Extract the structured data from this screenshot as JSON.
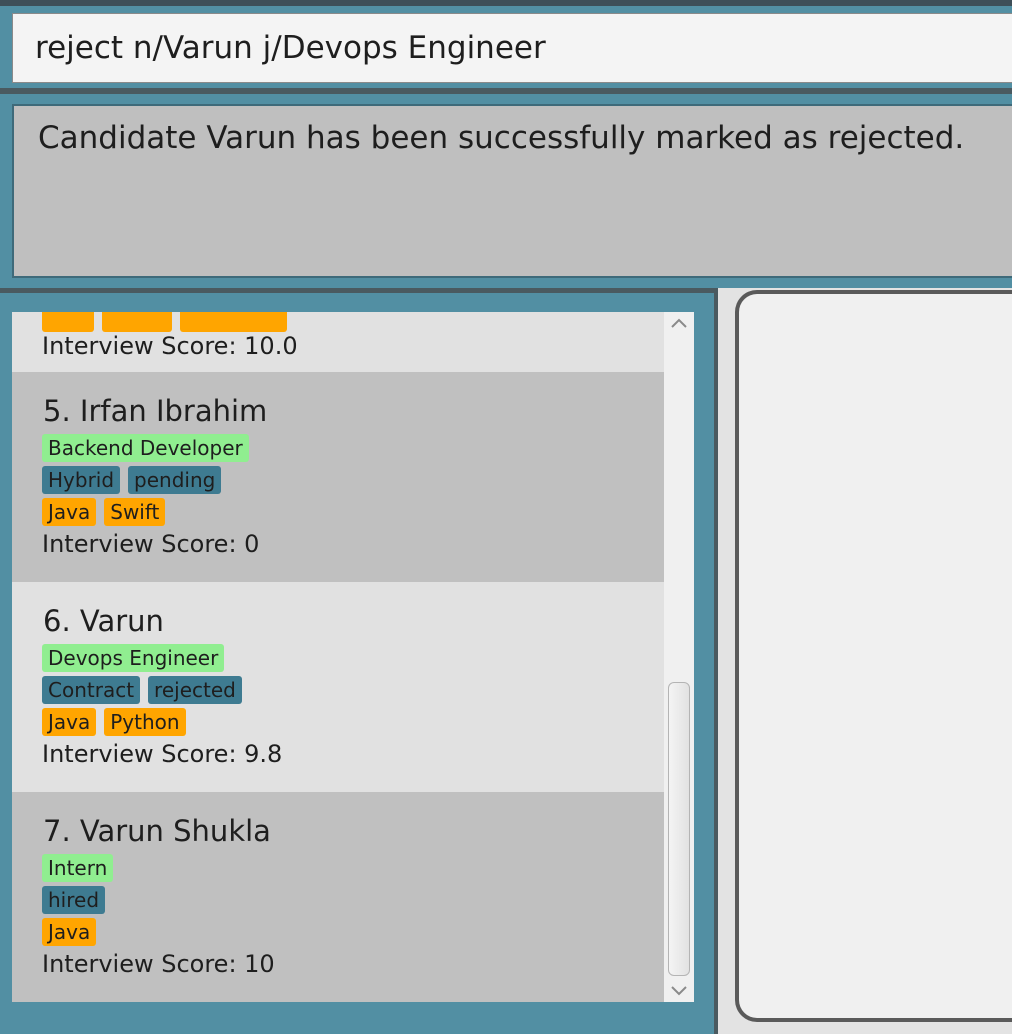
{
  "command": {
    "value": "reject n/Varun j/Devops Engineer"
  },
  "result": {
    "message": "Candidate Varun has been successfully marked as rejected."
  },
  "list": {
    "partial_card": {
      "score": "Interview Score: 10.0"
    },
    "candidates": [
      {
        "name": "5. Irfan Ibrahim",
        "role": "Backend Developer",
        "statuses": [
          "Hybrid",
          "pending"
        ],
        "skills": [
          "Java",
          "Swift"
        ],
        "score": "Interview Score: 0"
      },
      {
        "name": "6. Varun",
        "role": "Devops Engineer",
        "statuses": [
          "Contract",
          "rejected"
        ],
        "skills": [
          "Java",
          "Python"
        ],
        "score": "Interview Score: 9.8"
      },
      {
        "name": "7. Varun Shukla",
        "role": "Intern",
        "statuses": [
          "hired"
        ],
        "skills": [
          "Java"
        ],
        "score": "Interview Score: 10"
      }
    ]
  },
  "colors": {
    "role_tag": "#90ee90",
    "status_tag": "#3e7b91",
    "skill_tag": "#ffa500",
    "background": "#528fa3"
  },
  "icons": {
    "scroll_up": "chevron-up-icon",
    "scroll_down": "chevron-down-icon"
  }
}
